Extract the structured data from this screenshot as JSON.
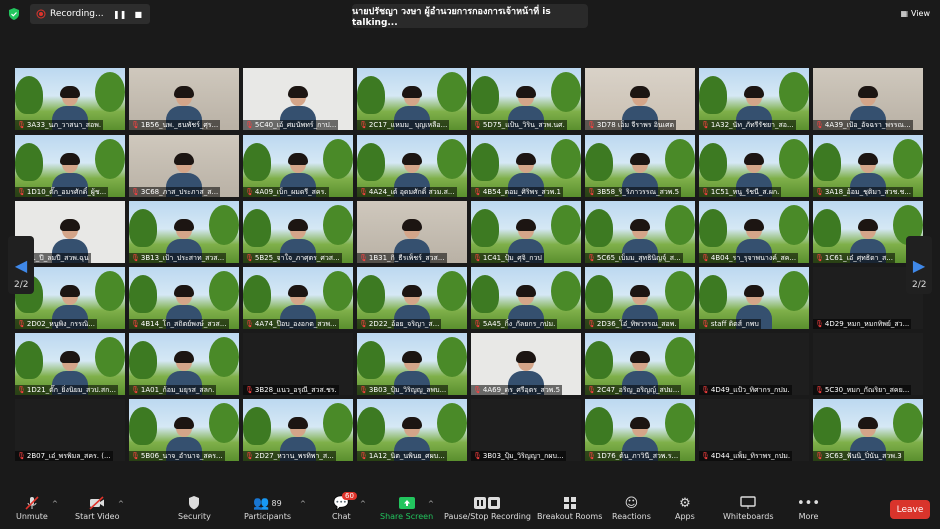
{
  "recording": {
    "label": "Recording..."
  },
  "speaker": {
    "text": "นายปรัชญา วงษา ผู้อำนวยการกองการเจ้าหน้าที่ is talking..."
  },
  "view": {
    "label": "View"
  },
  "pages": {
    "left": "2/2",
    "right": "2/2"
  },
  "participants": [
    {
      "name": "3A33_นภ_วาสนา_สอพ.",
      "bg": "nat"
    },
    {
      "name": "1B56_นพ._ธนพัชร์_ศุร...",
      "bg": "office"
    },
    {
      "name": "5C40_เอ้_ศมนัพทร์_กาป...",
      "bg": "white"
    },
    {
      "name": "2C17_แหมม_ บุญเหลือ...",
      "bg": "nat"
    },
    {
      "name": "5D75_แป้น_วิริน_สวพ.นศ.",
      "bg": "nat"
    },
    {
      "name": "3D78 เอ็ม จีราพร อินเศต",
      "bg": "wall"
    },
    {
      "name": "1A32_นัท_ภัทรีรัชยา_สอ...",
      "bg": "nat"
    },
    {
      "name": "4A39_เป้อ_อัจฉรา_พรรณ...",
      "bg": "office"
    },
    {
      "name": "1D10_ตั๊ก_อมรศักดิ์_ผู้ช...",
      "bg": "nat"
    },
    {
      "name": "3C68_ภาส_ประภาส_ส...",
      "bg": "office"
    },
    {
      "name": "4A09_เบ็ก_ผมดรี_สคร.",
      "bg": "nat"
    },
    {
      "name": "4A24_เต้ อุดมศักดิ์ สวม.ส...",
      "bg": "nat"
    },
    {
      "name": "4B54_ตอม_ศิริพร_สวพ.1",
      "bg": "nat"
    },
    {
      "name": "3B58_ริ_ริภาวรรณ_สวพ.5",
      "bg": "nat"
    },
    {
      "name": "1C51_หนู_รัชนี_ส.ผก.",
      "bg": "nat"
    },
    {
      "name": "3A18_อ้อม_ชุติมา_สวช.ช...",
      "bg": "nat"
    },
    {
      "name": "71_ปี_ลมปี_สวพ.ฉุน",
      "bg": "white"
    },
    {
      "name": "3B13_เป้า_ประสาท_สวส...",
      "bg": "nat"
    },
    {
      "name": "5B25_จาใจ_ภาศุตร_ศวส...",
      "bg": "nat"
    },
    {
      "name": "1B31_กิ_ธีรเพ็ชร์_สวส...",
      "bg": "office"
    },
    {
      "name": "1C41_ปุ้ม_ศุจิ_กวป",
      "bg": "nat"
    },
    {
      "name": "5C65_เบ็มม_สุทธินิญจุ์_ส...",
      "bg": "nat"
    },
    {
      "name": "4B04_รา_รุจาพนางค์_สค...",
      "bg": "nat"
    },
    {
      "name": "1C61_เอ๋_ศุทธิดา_ส...",
      "bg": "nat"
    },
    {
      "name": "2D02_หนูพิง_กรรณิ...",
      "bg": "nat"
    },
    {
      "name": "4B14_โก_สถิตย์พงษ์_สวส...",
      "bg": "nat"
    },
    {
      "name": "4A74_ป๊อบ_องอกต_สวพ...",
      "bg": "nat"
    },
    {
      "name": "2D22_อ้อย_จริญา_ส...",
      "bg": "nat"
    },
    {
      "name": "5A45_กิ้ง_กัลยกร_กปม.",
      "bg": "nat"
    },
    {
      "name": "2D36_โอ๋_ทิพวรรณ_สอพ.",
      "bg": "nat"
    },
    {
      "name": "staff ติตส์_กพบ",
      "bg": "nat"
    },
    {
      "name": "4D29_หมก_หมกทิพย์_สว...",
      "bg": "blank"
    },
    {
      "name": "1D21_ตั๊ก_ยิ่งนิยม_สวป.สก...",
      "bg": "nat"
    },
    {
      "name": "1A01_ก้อม_มยุรส_สลก.",
      "bg": "nat"
    },
    {
      "name": "3B28_แนว_อรุณี_สวส.ชร.",
      "bg": "blank"
    },
    {
      "name": "3B03_ปุ้ม_วิริญญ_ลพบ...",
      "bg": "nat"
    },
    {
      "name": "4A69_ดร_ศรีอุตร_สวพ.5",
      "bg": "white"
    },
    {
      "name": "2C47_อริญ_อริญญ์_สปม...",
      "bg": "nat"
    },
    {
      "name": "4D49_แป้ว_ทิศากร_กปม.",
      "bg": "blank"
    },
    {
      "name": "5C30_หมก_กัณริยา_สคย...",
      "bg": "blank"
    },
    {
      "name": "2B07_เอ๋_พรพิมล_สคร. (...",
      "bg": "blank"
    },
    {
      "name": "5B06_นาจ_อำนาจ_สคร...",
      "bg": "nat"
    },
    {
      "name": "2D27_หวาน_พรทิพา_ส...",
      "bg": "nat"
    },
    {
      "name": "1A12_นิต_นพินย_ศผบ...",
      "bg": "nat"
    },
    {
      "name": "3B03_ปุ้ม_วิริญญา_กผบ...",
      "bg": "blank"
    },
    {
      "name": "1D76_ต้น_ภาวินี_สวพ.ร...",
      "bg": "nat"
    },
    {
      "name": "4D44_แพ็ม_ทิราพร_กปม.",
      "bg": "blank"
    },
    {
      "name": "3C63_ฟันนิ_ปิ่นัน_สวพ.3",
      "bg": "nat"
    }
  ],
  "toolbar": {
    "unmute": "Unmute",
    "video": "Start Video",
    "security": "Security",
    "participants": "Participants",
    "participants_count": "89",
    "chat": "Chat",
    "chat_badge": "60",
    "share": "Share Screen",
    "record": "Pause/Stop Recording",
    "breakout": "Breakout Rooms",
    "reactions": "Reactions",
    "apps": "Apps",
    "whiteboards": "Whiteboards",
    "more": "More",
    "leave": "Leave"
  },
  "colors": {
    "share": "#22c55e",
    "leave": "#d9342b",
    "arrow": "#3f88e8"
  }
}
